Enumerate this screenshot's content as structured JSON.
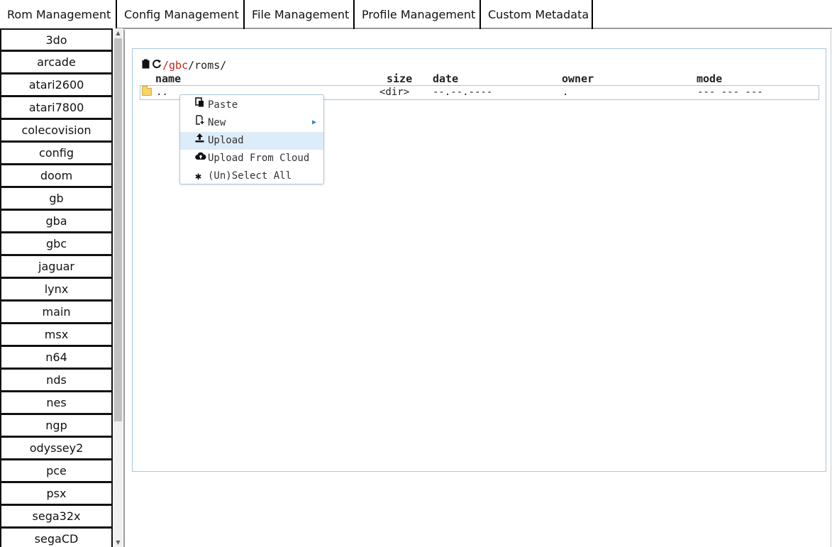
{
  "tabs": [
    {
      "label": "Rom Management"
    },
    {
      "label": "Config Management"
    },
    {
      "label": "File Management"
    },
    {
      "label": "Profile Management"
    },
    {
      "label": "Custom Metadata"
    }
  ],
  "sidebar": {
    "items": [
      {
        "label": "3do"
      },
      {
        "label": "arcade"
      },
      {
        "label": "atari2600"
      },
      {
        "label": "atari7800"
      },
      {
        "label": "colecovision"
      },
      {
        "label": "config"
      },
      {
        "label": "doom"
      },
      {
        "label": "gb"
      },
      {
        "label": "gba"
      },
      {
        "label": "gbc"
      },
      {
        "label": "jaguar"
      },
      {
        "label": "lynx"
      },
      {
        "label": "main"
      },
      {
        "label": "msx"
      },
      {
        "label": "n64"
      },
      {
        "label": "nds"
      },
      {
        "label": "nes"
      },
      {
        "label": "ngp"
      },
      {
        "label": "odyssey2"
      },
      {
        "label": "pce"
      },
      {
        "label": "psx"
      },
      {
        "label": "sega32x"
      },
      {
        "label": "segaCD"
      }
    ]
  },
  "browser": {
    "path": {
      "slash1": "/",
      "segment1": "gbc",
      "slash2": "/",
      "segment2": "roms",
      "slash3": "/"
    },
    "columns": {
      "name": "name",
      "size": "size",
      "date": "date",
      "owner": "owner",
      "mode": "mode"
    },
    "rows": [
      {
        "name": "..",
        "size": "<dir>",
        "date": "--.--.----",
        "owner": ".",
        "mode": "--- --- ---"
      }
    ]
  },
  "context_menu": {
    "items": [
      {
        "label": "Paste",
        "icon": "paste-icon"
      },
      {
        "label": "New",
        "icon": "new-file-icon"
      },
      {
        "label": "Upload",
        "icon": "upload-icon"
      },
      {
        "label": "Upload From Cloud",
        "icon": "cloud-upload-icon"
      },
      {
        "label": "(Un)Select All",
        "icon": "asterisk-icon"
      }
    ]
  },
  "colors": {
    "accent_path": "#cc1f1f",
    "panel_border": "#a9c7df",
    "menu_hover": "#dcecf9"
  }
}
